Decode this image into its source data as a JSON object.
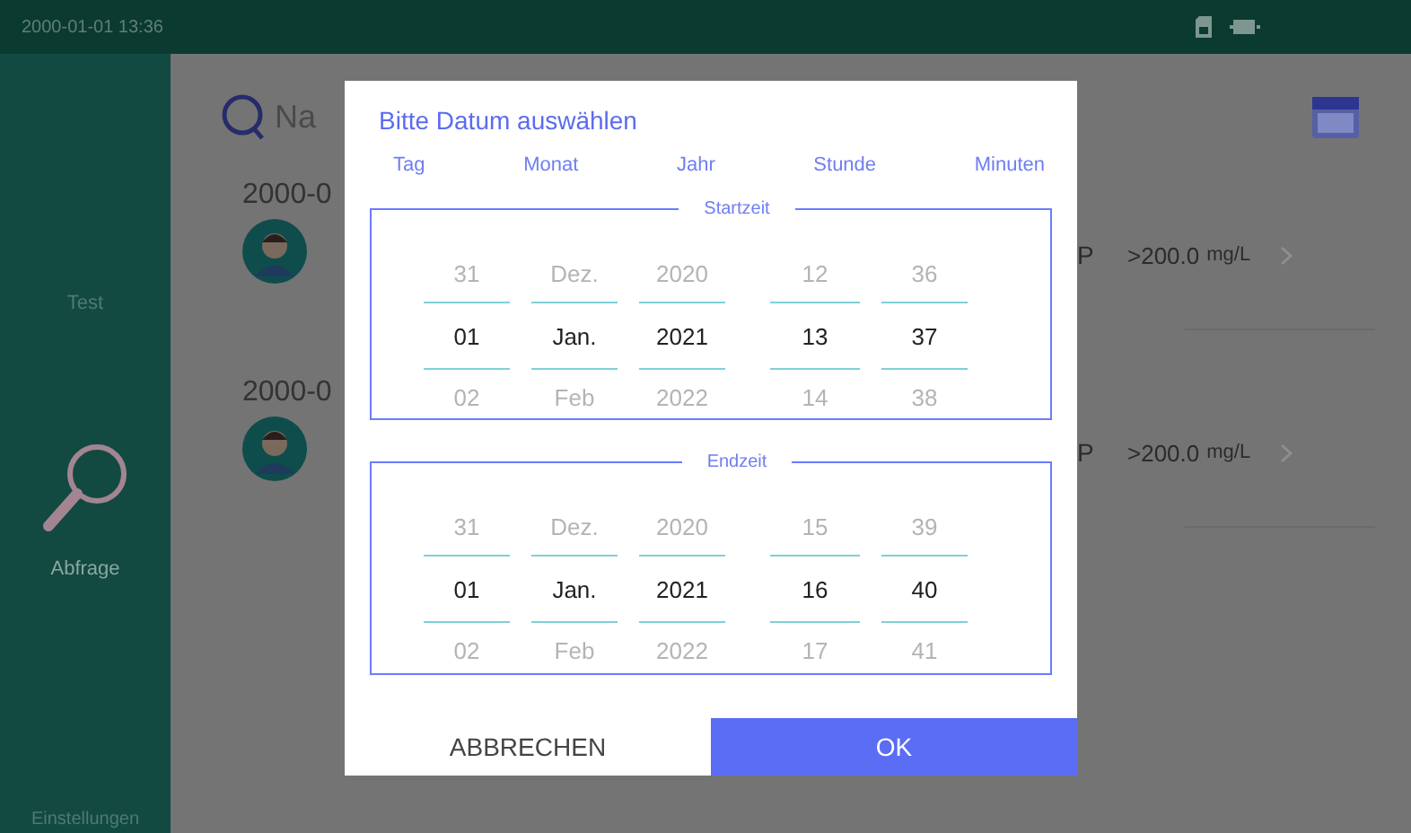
{
  "status_bar": {
    "time": "2000-01-01 13:36"
  },
  "sidebar": {
    "items": [
      {
        "label": "Test",
        "selected": false
      },
      {
        "label": "Abfrage",
        "selected": true
      },
      {
        "label": "Einstellungen",
        "selected": false
      }
    ]
  },
  "search": {
    "placeholder": "Na"
  },
  "records": [
    {
      "date": "2000-0",
      "item": "P",
      "value": ">200.0",
      "unit": "mg/L"
    },
    {
      "date": "2000-0",
      "item": "P",
      "value": ">200.0",
      "unit": "mg/L"
    }
  ],
  "dialog": {
    "title": "Bitte Datum auswählen",
    "headers": [
      "Tag",
      "Monat",
      "Jahr",
      "Stunde",
      "Minuten"
    ],
    "ranges": [
      {
        "label": "Startzeit",
        "columns": [
          {
            "items": [
              {
                "text": "31",
                "selected": false
              },
              {
                "text": "01",
                "selected": true
              },
              {
                "text": "02",
                "selected": false
              }
            ]
          },
          {
            "items": [
              {
                "text": "Dez.",
                "selected": false
              },
              {
                "text": "Jan.",
                "selected": true
              },
              {
                "text": "Feb",
                "selected": false
              }
            ]
          },
          {
            "items": [
              {
                "text": "2020",
                "selected": false
              },
              {
                "text": "2021",
                "selected": true
              },
              {
                "text": "2022",
                "selected": false
              }
            ]
          },
          {
            "items": [
              {
                "text": "12",
                "selected": false
              },
              {
                "text": "13",
                "selected": true
              },
              {
                "text": "14",
                "selected": false
              }
            ]
          },
          {
            "items": [
              {
                "text": "36",
                "selected": false
              },
              {
                "text": "37",
                "selected": true
              },
              {
                "text": "38",
                "selected": false
              }
            ]
          }
        ]
      },
      {
        "label": "Endzeit",
        "columns": [
          {
            "items": [
              {
                "text": "31",
                "selected": false
              },
              {
                "text": "01",
                "selected": true
              },
              {
                "text": "02",
                "selected": false
              }
            ]
          },
          {
            "items": [
              {
                "text": "Dez.",
                "selected": false
              },
              {
                "text": "Jan.",
                "selected": true
              },
              {
                "text": "Feb",
                "selected": false
              }
            ]
          },
          {
            "items": [
              {
                "text": "2020",
                "selected": false
              },
              {
                "text": "2021",
                "selected": true
              },
              {
                "text": "2022",
                "selected": false
              }
            ]
          },
          {
            "items": [
              {
                "text": "15",
                "selected": false
              },
              {
                "text": "16",
                "selected": true
              },
              {
                "text": "17",
                "selected": false
              }
            ]
          },
          {
            "items": [
              {
                "text": "39",
                "selected": false
              },
              {
                "text": "40",
                "selected": true
              },
              {
                "text": "41",
                "selected": false
              }
            ]
          }
        ]
      }
    ],
    "buttons": [
      {
        "kind": "cancel",
        "label": "ABBRECHEN"
      },
      {
        "kind": "ok",
        "label": "OK"
      }
    ]
  }
}
